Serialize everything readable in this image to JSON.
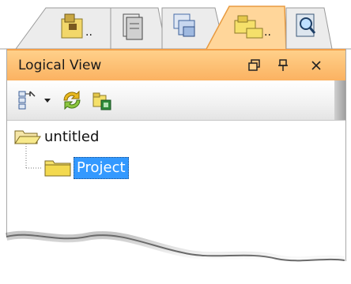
{
  "tabs": [
    {
      "icon": "folder-box-icon",
      "label": ".."
    },
    {
      "icon": "document-stack-icon",
      "label": ""
    },
    {
      "icon": "windows-stack-icon",
      "label": ""
    },
    {
      "icon": "folder-tree-icon",
      "label": "..",
      "active": true
    },
    {
      "icon": "magnifier-icon",
      "label": ""
    }
  ],
  "panel": {
    "title": "Logical View",
    "buttons": {
      "restore": "⊡",
      "pin": "ꟼ",
      "close": "✕"
    }
  },
  "toolbar": {
    "items": [
      "tree-view-icon",
      "dropdown-arrow-icon",
      "refresh-icon",
      "new-folder-icon"
    ]
  },
  "tree": {
    "root": {
      "label": "untitled",
      "icon": "open-folder-icon"
    },
    "children": [
      {
        "label": "Project",
        "icon": "folder-icon",
        "selected": true
      }
    ]
  },
  "colors": {
    "title_bar": "#fbb261",
    "accent": "#f3a04a",
    "selection": "#3399ff",
    "folder": "#f5e06a"
  }
}
